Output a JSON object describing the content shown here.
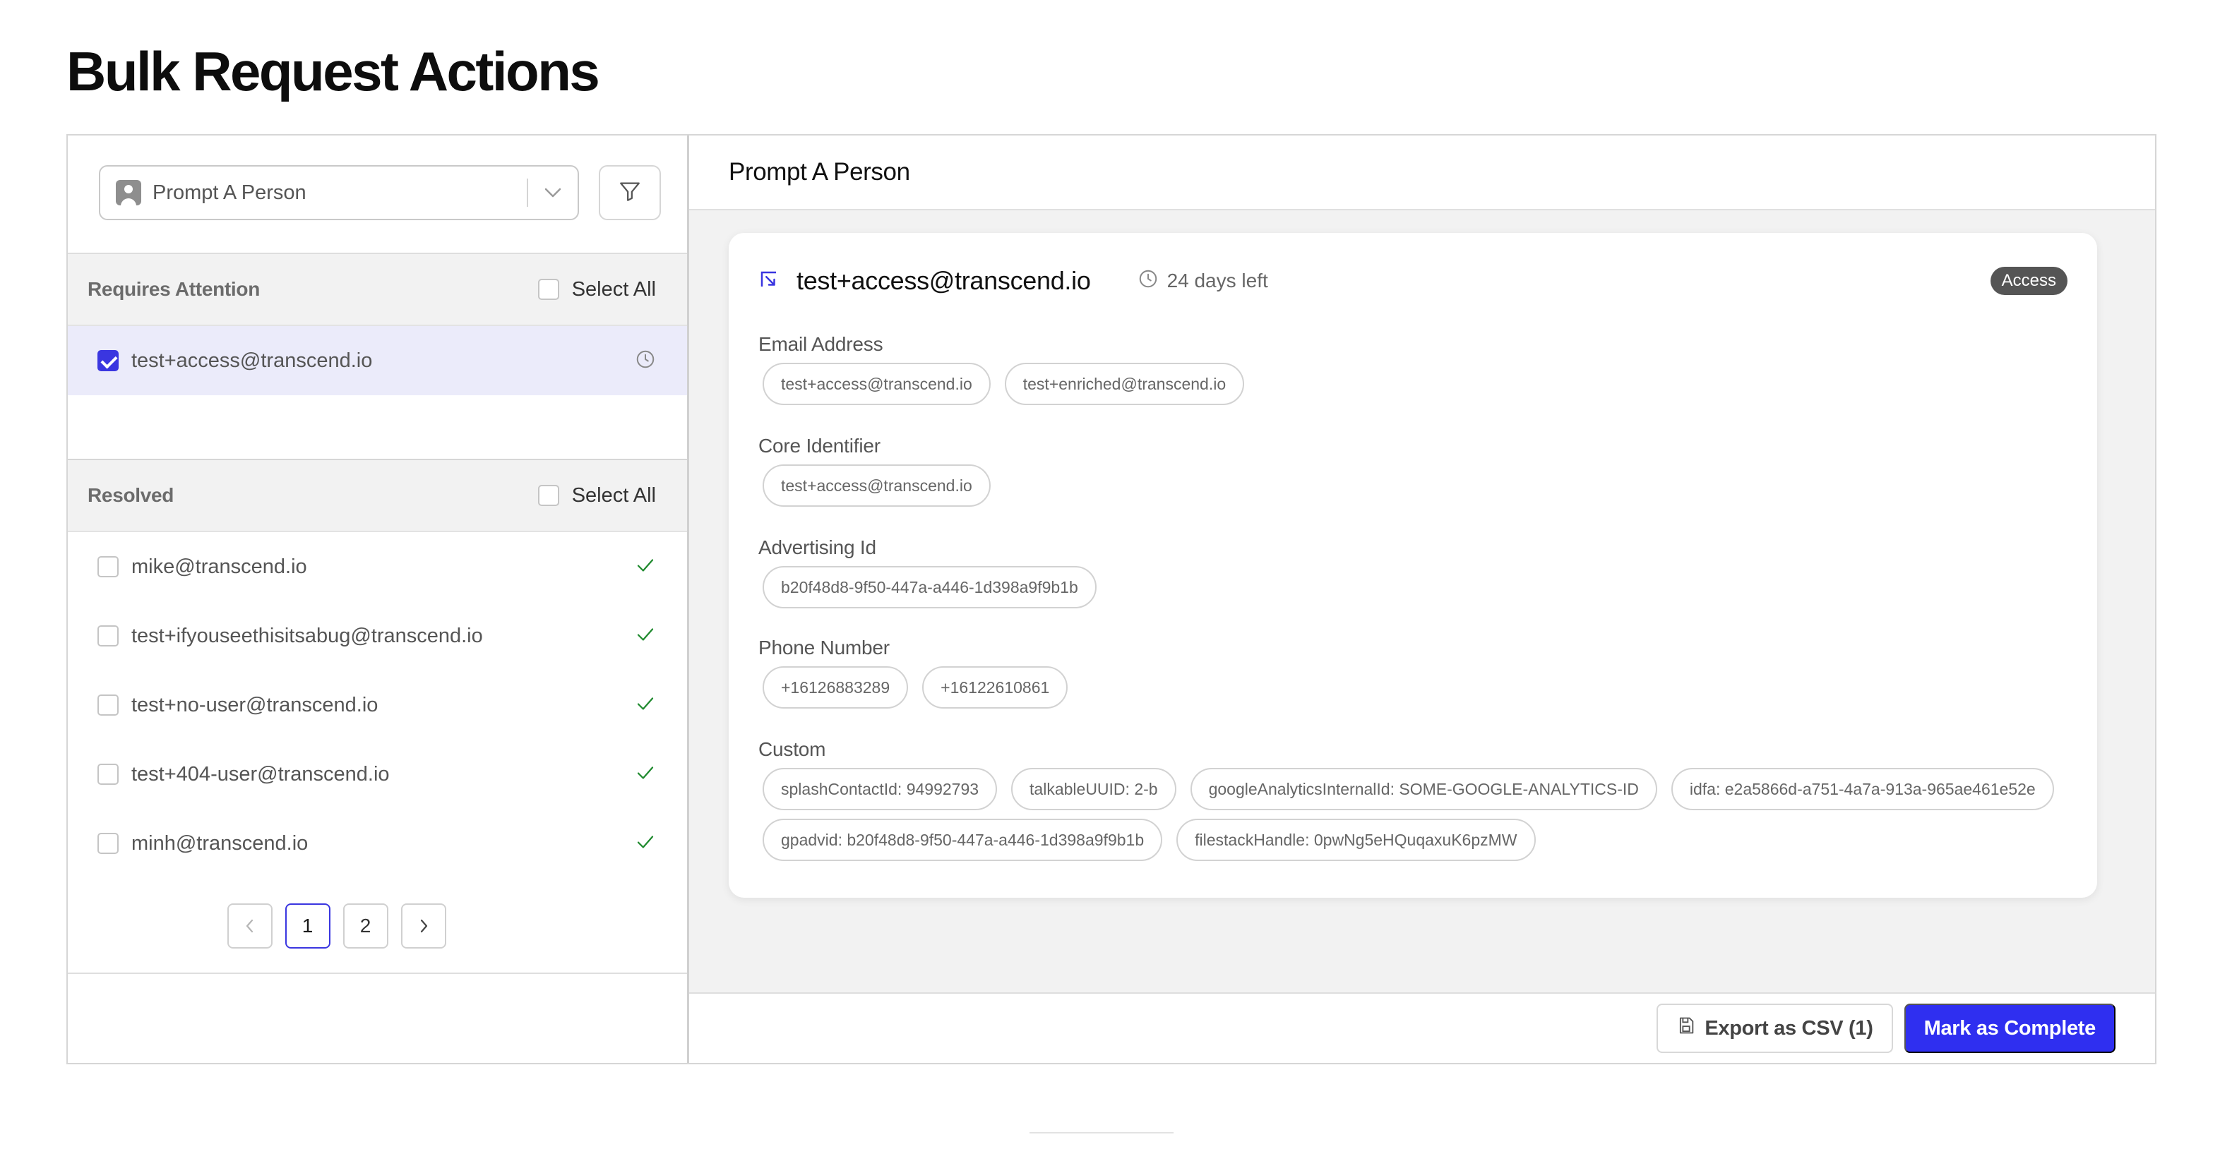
{
  "page": {
    "title": "Bulk Request Actions"
  },
  "colors": {
    "accent": "#2f2ff0",
    "check": "#1f8a2e",
    "highlight_row": "#ebebfa",
    "badge": "#555555"
  },
  "left": {
    "action_select": {
      "value": "Prompt A Person",
      "icon": "person-icon"
    },
    "filter_icon": "filter-icon",
    "requires_attention": {
      "title": "Requires Attention",
      "select_all": "Select All",
      "items": [
        {
          "label": "test+access@transcend.io",
          "checked": true,
          "status_icon": "clock-icon"
        }
      ]
    },
    "resolved": {
      "title": "Resolved",
      "select_all": "Select All",
      "items": [
        {
          "label": "mike@transcend.io",
          "status_icon": "check-icon"
        },
        {
          "label": "test+ifyouseethisitsabug@transcend.io",
          "status_icon": "check-icon"
        },
        {
          "label": "test+no-user@transcend.io",
          "status_icon": "check-icon"
        },
        {
          "label": "test+404-user@transcend.io",
          "status_icon": "check-icon"
        },
        {
          "label": "minh@transcend.io",
          "status_icon": "check-icon"
        }
      ]
    },
    "pagination": {
      "pages": [
        "1",
        "2"
      ],
      "current": "1"
    }
  },
  "right": {
    "header": "Prompt A Person",
    "card": {
      "email": "test+access@transcend.io",
      "days_left": "24 days left",
      "badge": "Access",
      "fields": [
        {
          "label": "Email Address",
          "values": [
            "test+access@transcend.io",
            "test+enriched@transcend.io"
          ]
        },
        {
          "label": "Core Identifier",
          "values": [
            "test+access@transcend.io"
          ]
        },
        {
          "label": "Advertising Id",
          "values": [
            "b20f48d8-9f50-447a-a446-1d398a9f9b1b"
          ]
        },
        {
          "label": "Phone Number",
          "values": [
            "+16126883289",
            "+16122610861"
          ]
        },
        {
          "label": "Custom",
          "values": [
            "splashContactId: 94992793",
            "talkableUUID: 2-b",
            "googleAnalyticsInternalId: SOME-GOOGLE-ANALYTICS-ID",
            "idfa: e2a5866d-a751-4a7a-913a-965ae461e52e",
            "gpadvid: b20f48d8-9f50-447a-a446-1d398a9f9b1b",
            "filestackHandle: 0pwNg5eHQuqaxuK6pzMW"
          ]
        }
      ]
    },
    "footer": {
      "export_label": "Export as CSV (1)",
      "complete_label": "Mark as Complete"
    }
  }
}
